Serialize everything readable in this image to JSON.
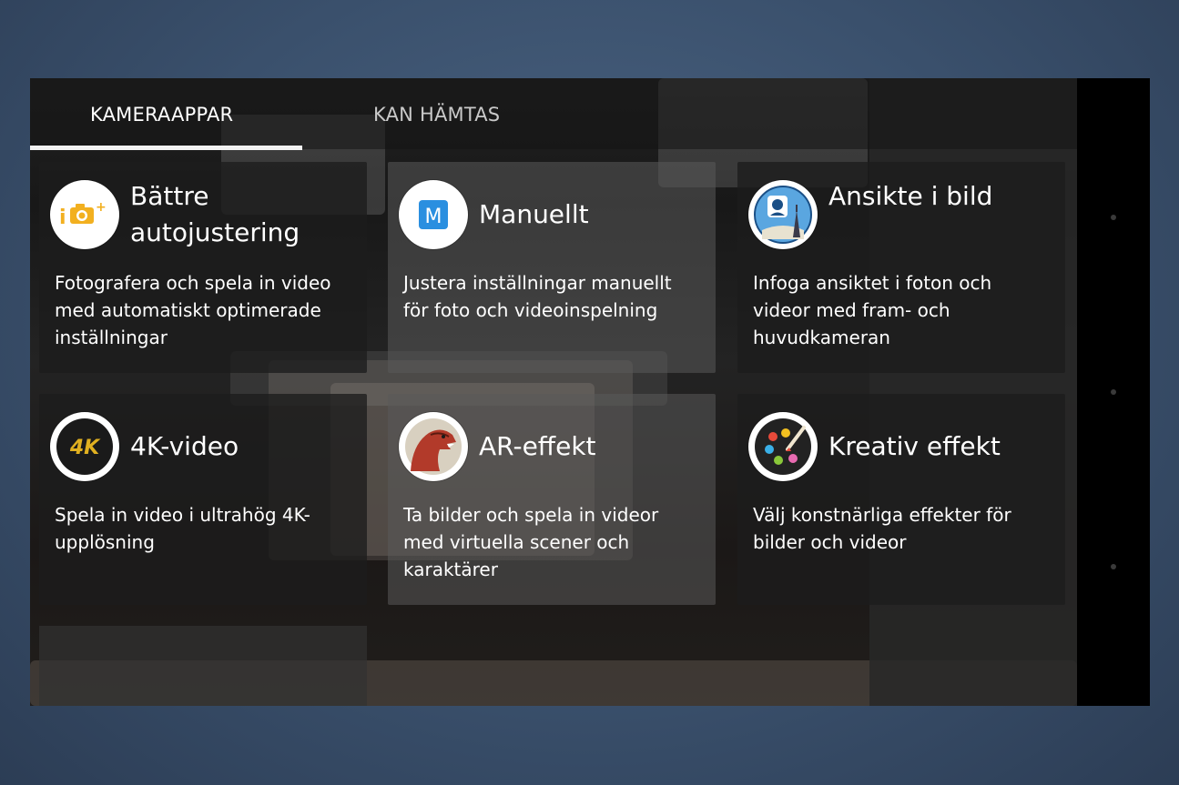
{
  "tabs": [
    {
      "label": "KAMERAAPPAR",
      "active": true
    },
    {
      "label": "KAN HÄMTAS",
      "active": false
    }
  ],
  "apps": [
    {
      "title": "Bättre autojustering",
      "description": "Fotografera och spela in video med automatiskt optimerade inställningar",
      "icon": "superior-auto-icon",
      "icon_color": "#f2b020"
    },
    {
      "title": "Manuellt",
      "description": "Justera inställningar manuellt för foto och videoinspelning",
      "icon": "manual-m-icon",
      "icon_color": "#2a8fe0"
    },
    {
      "title": "Ansikte i bild",
      "description": "Infoga ansiktet i foton och videor med fram- och huvudkameran",
      "icon": "face-in-picture-icon",
      "icon_color": "#2a7fc8"
    },
    {
      "title": "4K-video",
      "description": "Spela in video i ultrahög 4K-upplösning",
      "icon": "4k-icon",
      "icon_color": "#e0b020"
    },
    {
      "title": "AR-effekt",
      "description": "Ta bilder och spela in videor med virtuella scener och karaktärer",
      "icon": "dinosaur-icon",
      "icon_color": "#b23a2a"
    },
    {
      "title": "Kreativ effekt",
      "description": "Välj konstnärliga effekter för bilder och videor",
      "icon": "palette-icon",
      "icon_color": "#333333"
    }
  ]
}
